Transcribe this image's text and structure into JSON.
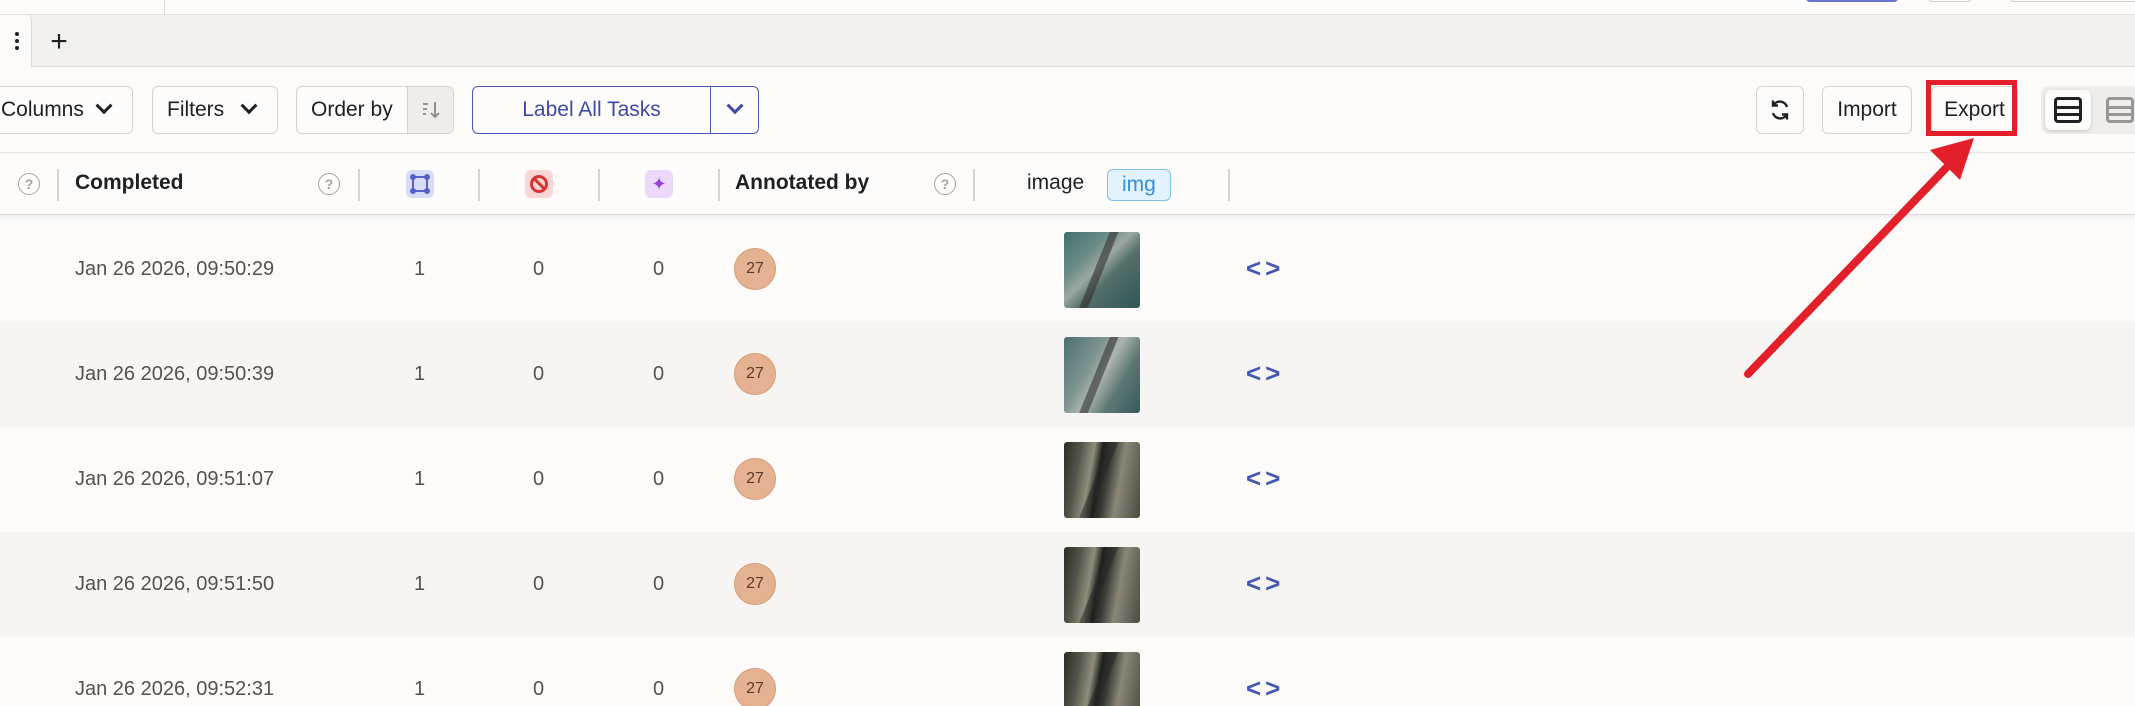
{
  "tabs": {
    "add_label": "+"
  },
  "toolbar": {
    "columns_label": "Columns",
    "filters_label": "Filters",
    "order_by_label": "Order by",
    "label_all_label": "Label All Tasks",
    "import_label": "Import",
    "export_label": "Export"
  },
  "table": {
    "headers": {
      "completed": "Completed",
      "annotated_by": "Annotated by",
      "image": "image",
      "image_tag": "img",
      "help": "?"
    },
    "rows": [
      {
        "completed": "Jan 26 2026, 09:50:29",
        "annotations": "1",
        "cancelled": "0",
        "predictions": "0",
        "annotator": "27"
      },
      {
        "completed": "Jan 26 2026, 09:50:39",
        "annotations": "1",
        "cancelled": "0",
        "predictions": "0",
        "annotator": "27"
      },
      {
        "completed": "Jan 26 2026, 09:51:07",
        "annotations": "1",
        "cancelled": "0",
        "predictions": "0",
        "annotator": "27"
      },
      {
        "completed": "Jan 26 2026, 09:51:50",
        "annotations": "1",
        "cancelled": "0",
        "predictions": "0",
        "annotator": "27"
      },
      {
        "completed": "Jan 26 2026, 09:52:31",
        "annotations": "1",
        "cancelled": "0",
        "predictions": "0",
        "annotator": "27"
      }
    ],
    "code_glyph": "<>"
  },
  "colors": {
    "accent": "#3d4aa8",
    "highlight": "#e3202a",
    "avatar": "#e4b291"
  }
}
